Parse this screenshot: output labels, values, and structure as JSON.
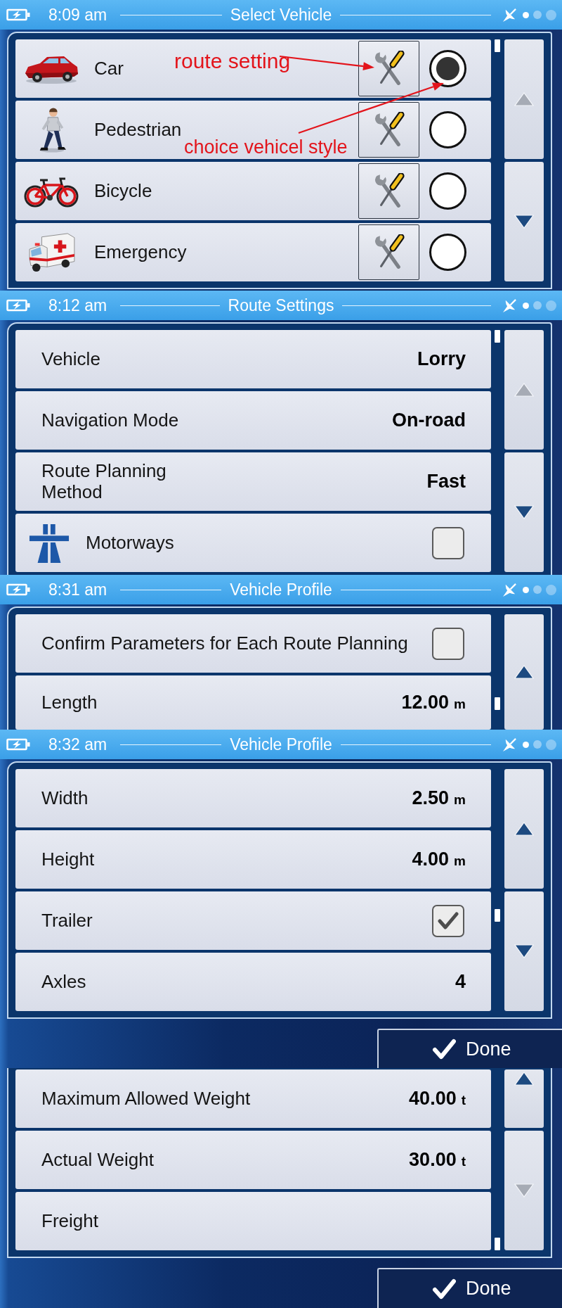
{
  "screens": [
    {
      "time": "8:09 am",
      "title": "Select Vehicle",
      "scroll_up": {
        "disabled": true
      },
      "scroll_down": {
        "disabled": false
      },
      "rows": [
        {
          "kind": "vehicle",
          "label": "Car",
          "selected": true
        },
        {
          "kind": "vehicle",
          "label": "Pedestrian",
          "selected": false
        },
        {
          "kind": "vehicle",
          "label": "Bicycle",
          "selected": false
        },
        {
          "kind": "vehicle",
          "label": "Emergency",
          "selected": false
        }
      ],
      "annotations": [
        {
          "text": "route setting"
        },
        {
          "text": "choice vehicel style"
        }
      ]
    },
    {
      "time": "8:12 am",
      "title": "Route Settings",
      "scroll_up": {
        "disabled": true
      },
      "scroll_down": {
        "disabled": false
      },
      "rows": [
        {
          "kind": "value",
          "label": "Vehicle",
          "value": "Lorry"
        },
        {
          "kind": "value",
          "label": "Navigation Mode",
          "value": "On-road"
        },
        {
          "kind": "value",
          "label": "Route Planning\nMethod",
          "value": "Fast"
        },
        {
          "kind": "toggle",
          "label": "Motorways",
          "checked": false
        }
      ]
    },
    {
      "time": "8:31 am",
      "title": "Vehicle Profile",
      "scroll_up": {
        "disabled": false
      },
      "rows": [
        {
          "kind": "toggle",
          "label": "Confirm Parameters for Each Route Planning",
          "checked": false
        },
        {
          "kind": "value",
          "label": "Length",
          "value": "12.00",
          "unit": "m"
        }
      ]
    },
    {
      "time": "8:32 am",
      "title": "Vehicle Profile",
      "scroll_up": {
        "disabled": false
      },
      "scroll_down": {
        "disabled": false
      },
      "rows": [
        {
          "kind": "value",
          "label": "Width",
          "value": "2.50",
          "unit": "m"
        },
        {
          "kind": "value",
          "label": "Height",
          "value": "4.00",
          "unit": "m"
        },
        {
          "kind": "toggle",
          "label": "Trailer",
          "checked": true
        },
        {
          "kind": "value",
          "label": "Axles",
          "value": "4"
        }
      ],
      "done": "Done"
    },
    {
      "scroll_up": {
        "disabled": false
      },
      "scroll_down": {
        "disabled": true
      },
      "rows": [
        {
          "kind": "value",
          "label": "Maximum Allowed Weight",
          "value": "40.00",
          "unit": "t"
        },
        {
          "kind": "value",
          "label": "Actual Weight",
          "value": "30.00",
          "unit": "t"
        },
        {
          "kind": "link",
          "label": "Freight"
        }
      ],
      "done": "Done"
    }
  ]
}
